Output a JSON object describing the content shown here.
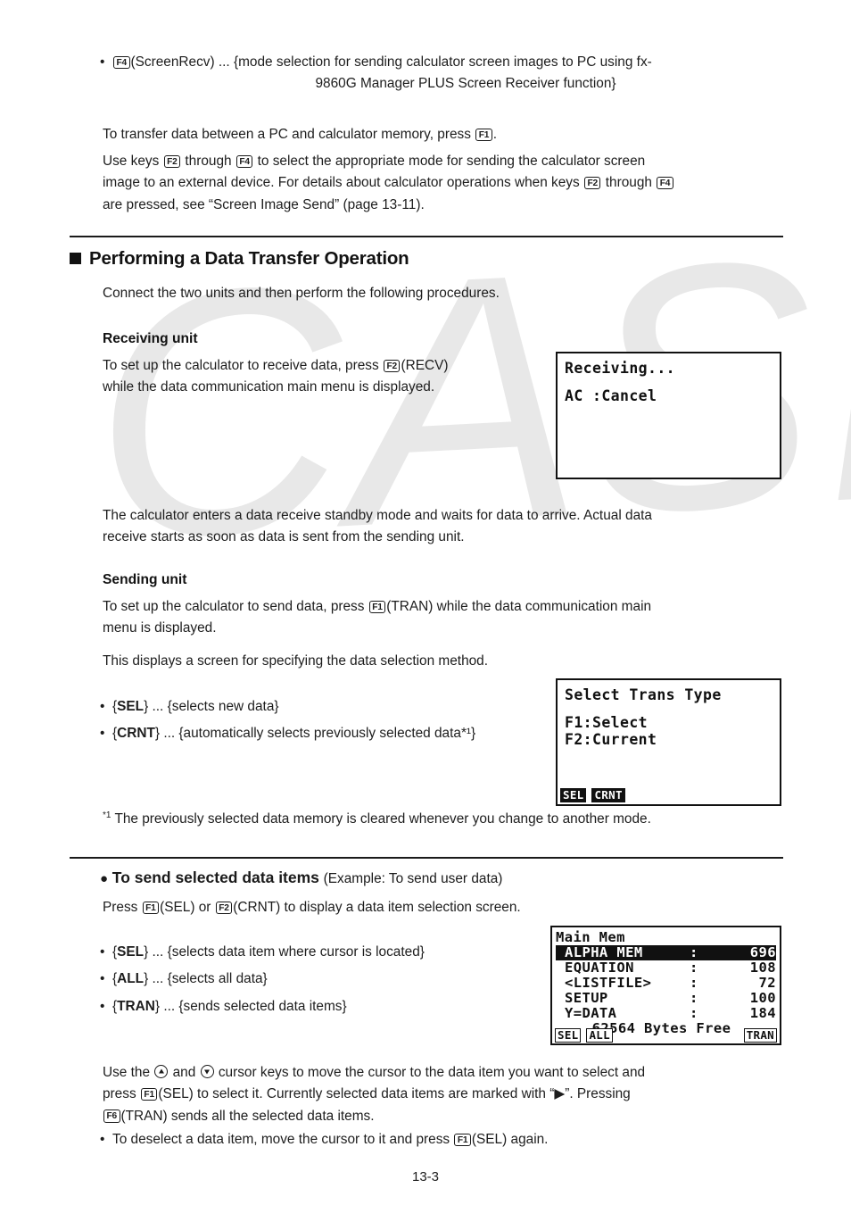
{
  "page": {
    "number": "13-3"
  },
  "watermark": {
    "text": "CASIO",
    "color": "#e8e8e8"
  },
  "intro": {
    "bullet_f4_key": "F4",
    "bullet_f4_line1": "(ScreenRecv) ... {mode selection for sending calculator screen images to PC using fx-",
    "bullet_f4_line2": "9860G Manager PLUS Screen Receiver function}",
    "para1_a": "To transfer data between a PC and calculator memory, press",
    "para1_key": "F1",
    "para1_b": ".",
    "para2_a": "Use keys",
    "para2_key1": "F2",
    "para2_b": "through",
    "para2_key2": "F4",
    "para2_c": "to select the appropriate mode for sending the calculator screen",
    "para2_d": "image to an external device. For details about calculator operations when keys",
    "para2_key3": "F2",
    "para2_e": "through",
    "para2_key4": "F4",
    "para2_f": "are pressed, see “Screen Image Send” (page 13-11)."
  },
  "section": {
    "heading": "Performing a Data Transfer Operation",
    "intro_line": "Connect the two units and then perform the following procedures."
  },
  "receiving": {
    "heading": "Receiving unit",
    "line1_a": "To set up the calculator to receive data, press",
    "line1_key": "F2",
    "line1_b": "(RECV)",
    "line2": "while the data communication main menu is displayed.",
    "after_a": "The calculator enters a data receive standby mode and waits for data to arrive. Actual data",
    "after_b": "receive starts as soon as data is sent from the sending unit."
  },
  "sending": {
    "heading": "Sending unit",
    "line1_a": "To set up the calculator to send data, press",
    "line1_key": "F1",
    "line1_b": "(TRAN) while the data communication main",
    "line2": "menu is displayed.",
    "line3": "This displays a screen for specifying the data selection method.",
    "bullets": [
      {
        "label": "SEL",
        "desc": "... {selects new data}"
      },
      {
        "label": "CRNT",
        "desc": "... {automatically selects previously selected data*¹}"
      }
    ],
    "footnote_marker": "*1",
    "footnote_text": "The previously selected data memory is cleared whenever you change to another mode."
  },
  "send_items": {
    "heading_bold": "To send selected data items",
    "heading_rest": "(Example: To send user data)",
    "press_a": "Press",
    "press_key1": "F1",
    "press_b": "(SEL) or",
    "press_key2": "F2",
    "press_c": "(CRNT) to display a data item selection screen.",
    "bullets": [
      {
        "label": "SEL",
        "desc": "... {selects data item where cursor is located}"
      },
      {
        "label": "ALL",
        "desc": "... {selects all data}"
      },
      {
        "label": "TRAN",
        "desc": "... {sends selected data items}"
      }
    ],
    "closing_a": "Use the",
    "closing_b": "and",
    "closing_c": "cursor keys to move the cursor to the data item you want to select and",
    "closing_d": "press",
    "closing_key1": "F1",
    "closing_e": "(SEL) to select it. Currently selected data items are marked with “▶”. Pressing",
    "closing_key2": "F6",
    "closing_f": "(TRAN) sends all the selected data items.",
    "deselect_a": "To deselect a data item, move the cursor to it and press",
    "deselect_key": "F1",
    "deselect_b": "(SEL) again."
  },
  "lcd_receiving": {
    "line1": "Receiving...",
    "line2": "AC :Cancel"
  },
  "lcd_trans_type": {
    "title": "Select Trans Type",
    "line1": "F1:Select",
    "line2": "F2:Current",
    "fkeys": [
      {
        "label": "SEL",
        "inverse": true
      },
      {
        "label": "CRNT",
        "inverse": true
      }
    ]
  },
  "lcd_main_mem": {
    "title": "Main Mem",
    "rows": [
      {
        "name": "ALPHA MEM",
        "sep": ":",
        "size": "696",
        "selected": true
      },
      {
        "name": "EQUATION",
        "sep": ":",
        "size": "108",
        "selected": false
      },
      {
        "name": "<LISTFILE>",
        "sep": ":",
        "size": "72",
        "selected": false
      },
      {
        "name": "SETUP",
        "sep": ":",
        "size": "100",
        "selected": false
      },
      {
        "name": "Y=DATA",
        "sep": ":",
        "size": "184",
        "selected": false
      }
    ],
    "free_text": "62564 Bytes Free",
    "fkeys_left": [
      {
        "label": "SEL"
      },
      {
        "label": "ALL"
      }
    ],
    "fkeys_right": [
      {
        "label": "TRAN"
      }
    ]
  }
}
